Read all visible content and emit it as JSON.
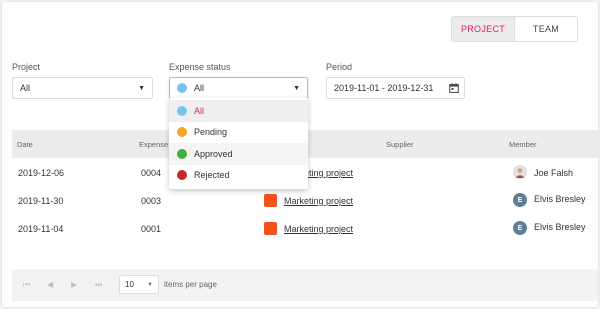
{
  "view_toggle": {
    "project": "PROJECT",
    "team": "TEAM",
    "active": "PROJECT"
  },
  "filters": {
    "project": {
      "label": "Project",
      "value": "All"
    },
    "status": {
      "label": "Expense status",
      "value": "All",
      "dot_color": "#79c4ef"
    },
    "period": {
      "label": "Period",
      "value": "2019-11-01 - 2019-12-31"
    }
  },
  "table": {
    "columns": [
      "Date",
      "Expense",
      "Supplier",
      "Member"
    ],
    "rows": [
      {
        "date": "2019-12-06",
        "expense": "0004",
        "project": "Marketing project",
        "member": "Joe Falsh",
        "avatar": ""
      },
      {
        "date": "2019-11-30",
        "expense": "0003",
        "project": "Marketing project",
        "member": "Elvis Bresley",
        "avatar": "E"
      },
      {
        "date": "2019-11-04",
        "expense": "0001",
        "project": "Marketing project",
        "member": "Elvis Bresley",
        "avatar": "E"
      }
    ]
  },
  "pager": {
    "page_size": "10",
    "items_per_page": "items per page"
  },
  "status_menu": {
    "items": [
      {
        "label": "All",
        "color": "#79c4ef"
      },
      {
        "label": "Pending",
        "color": "#f5a623"
      },
      {
        "label": "Approved",
        "color": "#3cb043"
      },
      {
        "label": "Rejected",
        "color": "#c62828"
      }
    ]
  },
  "colors": {
    "accent": "#e0245e",
    "project_chip": "#f4511e",
    "avatar": "#5f7d95"
  },
  "icons": {
    "caret": "caret-down-icon",
    "calendar": "calendar-icon",
    "pager": [
      "first-page-icon",
      "prev-page-icon",
      "next-page-icon",
      "last-page-icon"
    ]
  }
}
